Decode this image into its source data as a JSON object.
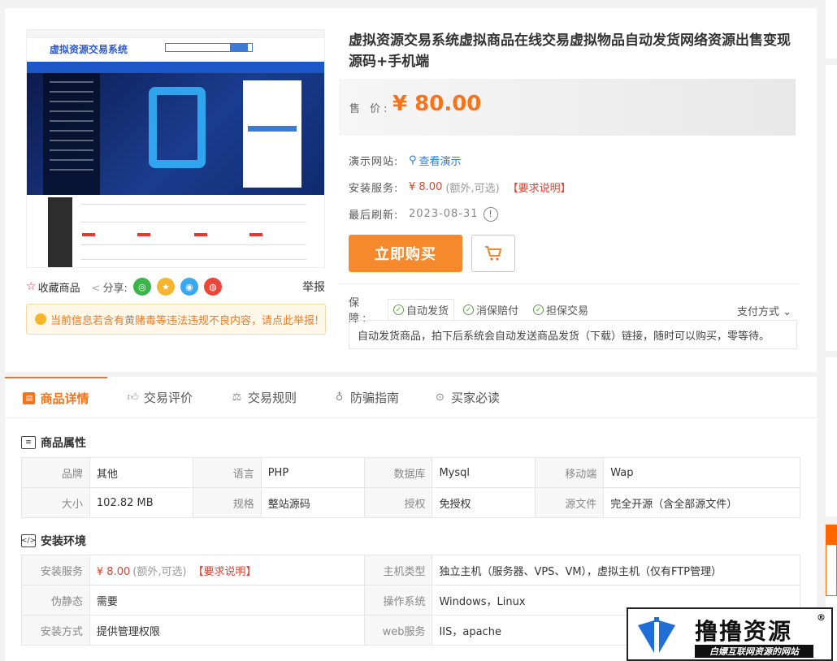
{
  "product": {
    "title": "虚拟资源交易系统虚拟商品在线交易虚拟物品自动发货网络资源出售变现源码+手机端",
    "price_label": "售  价:",
    "price": "¥ 80.00",
    "demo_label": "演示网站:",
    "demo_link": "查看演示",
    "install_label": "安装服务:",
    "install_price": "¥ 8.00",
    "install_note": "(额外,可选)",
    "install_req": "【要求说明】",
    "refresh_label": "最后刷新:",
    "refresh_date": "2023-08-31",
    "alert_glyph": "!",
    "buy_label": "立即购买",
    "cart_icon": "cart-icon"
  },
  "preview": {
    "logo_text": "虚拟资源交易系统"
  },
  "actions": {
    "favorite": "收藏商品",
    "share": "分享:",
    "share_targets": [
      {
        "name": "wechat",
        "glyph": "◎",
        "color": "#3bb54a"
      },
      {
        "name": "qzone",
        "glyph": "★",
        "color": "#f5b62c"
      },
      {
        "name": "qq",
        "glyph": "◉",
        "color": "#3aa8f0"
      },
      {
        "name": "weibo",
        "glyph": "◍",
        "color": "#e8473a"
      }
    ],
    "report": "举报"
  },
  "warning": "当前信息若含有黄赌毒等违法违规不良内容，请点此举报!",
  "guarantee": {
    "label": "保  障:",
    "items": [
      "自动发货",
      "消保赔付",
      "担保交易"
    ],
    "pay_method": "支付方式",
    "description": "自动发货商品，拍下后系统会自动发送商品发货（下载）链接，随时可以购买，零等待。"
  },
  "tabs": [
    "商品详情",
    "交易评价",
    "交易规则",
    "防骗指南",
    "买家必读"
  ],
  "attributes": {
    "title": "商品属性",
    "rows": [
      [
        [
          "品牌",
          "其他"
        ],
        [
          "语言",
          "PHP"
        ],
        [
          "数据库",
          "Mysql"
        ],
        [
          "移动端",
          "Wap"
        ]
      ],
      [
        [
          "大小",
          "102.82 MB"
        ],
        [
          "规格",
          "整站源码"
        ],
        [
          "授权",
          "免授权"
        ],
        [
          "源文件",
          "完全开源（含全部源文件）"
        ]
      ]
    ]
  },
  "environment": {
    "title": "安装环境",
    "install_key": "安装服务",
    "install_price": "¥ 8.00",
    "install_note": "(额外,可选)",
    "install_req": "【要求说明】",
    "host_key": "主机类型",
    "host_val": "独立主机（服务器、VPS、VM），虚拟主机（仅有FTP管理）",
    "pseudo_key": "伪静态",
    "pseudo_val": "需要",
    "os_key": "操作系统",
    "os_val": "Windows，Linux",
    "method_key": "安装方式",
    "method_val": "提供管理权限",
    "web_key": "web服务",
    "web_val": "IIS，apache"
  },
  "watermark": {
    "brand": "撸撸资源",
    "reg": "®",
    "slogan": "白嫖互联网资源的网站"
  },
  "colors": {
    "accent": "#f5731a",
    "buy": "#f5892b",
    "link": "#2d7be5",
    "red": "#d43"
  }
}
